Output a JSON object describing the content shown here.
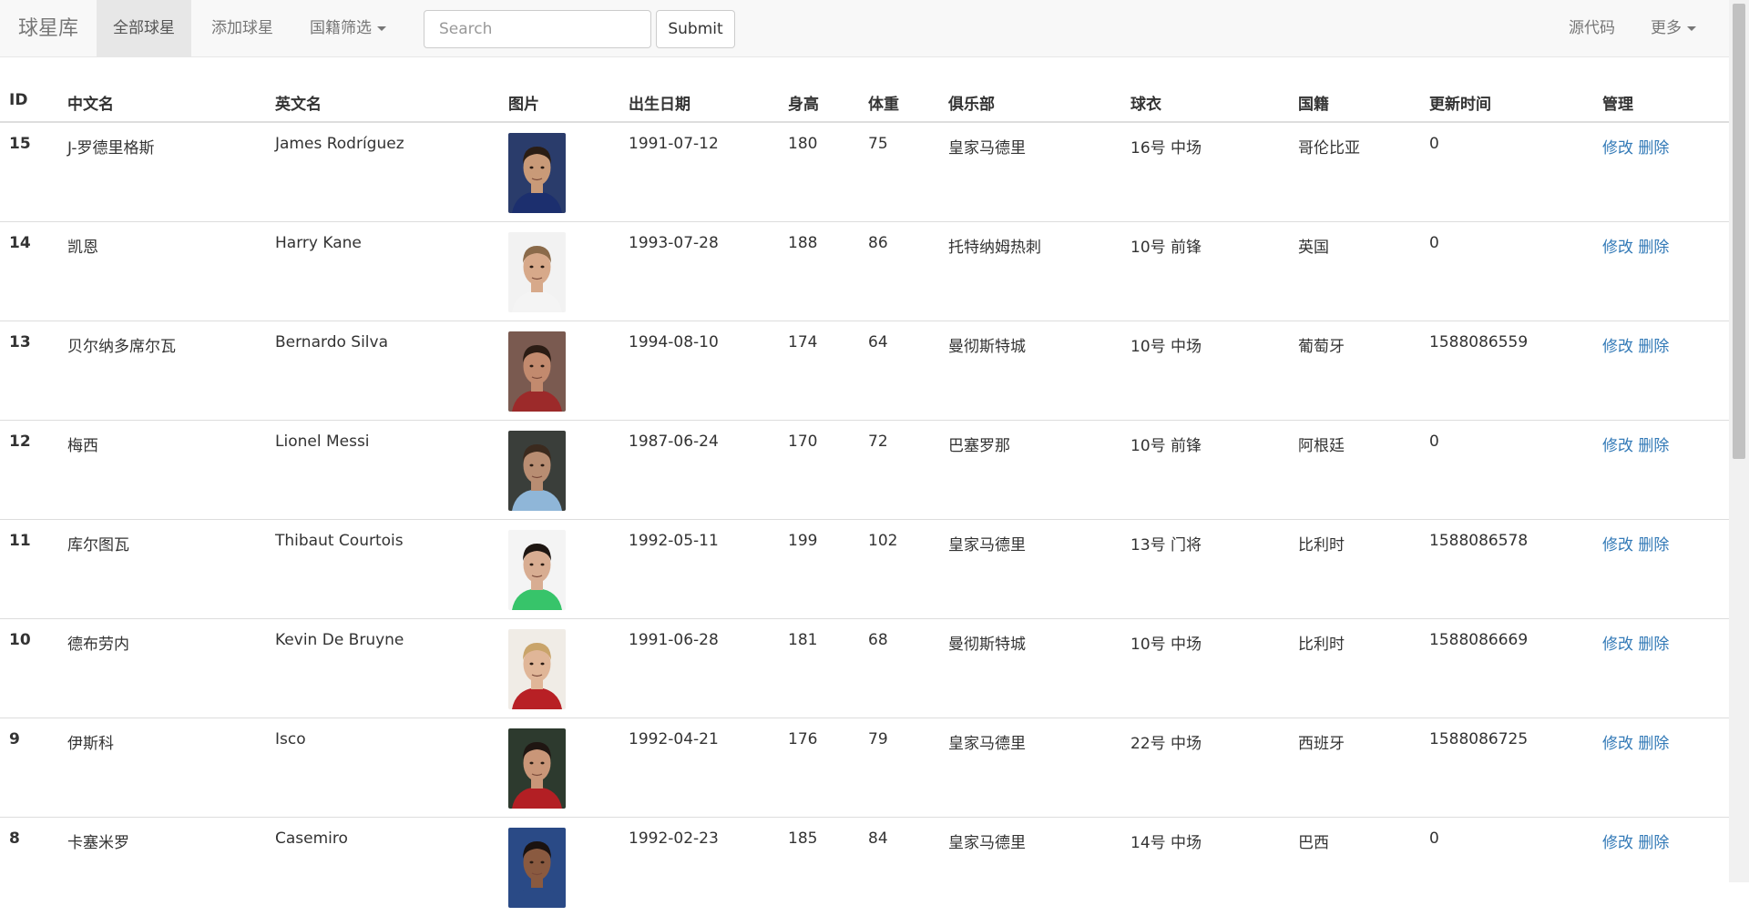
{
  "navbar": {
    "brand": "球星库",
    "items": [
      {
        "label": "全部球星"
      },
      {
        "label": "添加球星"
      },
      {
        "label": "国籍筛选"
      }
    ],
    "search_placeholder": "Search",
    "submit_label": "Submit",
    "right_items": [
      {
        "label": "源代码"
      },
      {
        "label": "更多"
      }
    ]
  },
  "table": {
    "headers": [
      "ID",
      "中文名",
      "英文名",
      "图片",
      "出生日期",
      "身高",
      "体重",
      "俱乐部",
      "球衣",
      "国籍",
      "更新时间",
      "管理"
    ],
    "rows": [
      {
        "id": "15",
        "cn": "J-罗德里格斯",
        "en": "James Rodríguez",
        "birth": "1991-07-12",
        "height": "180",
        "weight": "75",
        "club": "皇家马德里",
        "shirt": "16号 中场",
        "nation": "哥伦比亚",
        "updated": "0",
        "edit": "修改",
        "del": "删除",
        "photo": {
          "bg": "#2a3c6b",
          "skin": "#c99a78",
          "hair": "#2a1d14",
          "shirt": "#1c2f6e"
        }
      },
      {
        "id": "14",
        "cn": "凯恩",
        "en": "Harry Kane",
        "birth": "1993-07-28",
        "height": "188",
        "weight": "86",
        "club": "托特纳姆热刺",
        "shirt": "10号 前锋",
        "nation": "英国",
        "updated": "0",
        "edit": "修改",
        "del": "删除",
        "photo": {
          "bg": "#f2f2f2",
          "skin": "#d7a98a",
          "hair": "#8a6a4a",
          "shirt": "#f4f4f4"
        }
      },
      {
        "id": "13",
        "cn": "贝尔纳多席尔瓦",
        "en": "Bernardo Silva",
        "birth": "1994-08-10",
        "height": "174",
        "weight": "64",
        "club": "曼彻斯特城",
        "shirt": "10号 中场",
        "nation": "葡萄牙",
        "updated": "1588086559",
        "edit": "修改",
        "del": "删除",
        "photo": {
          "bg": "#7a5a50",
          "skin": "#c28a6e",
          "hair": "#2b1c14",
          "shirt": "#9c2a2a"
        }
      },
      {
        "id": "12",
        "cn": "梅西",
        "en": "Lionel Messi",
        "birth": "1987-06-24",
        "height": "170",
        "weight": "72",
        "club": "巴塞罗那",
        "shirt": "10号 前锋",
        "nation": "阿根廷",
        "updated": "0",
        "edit": "修改",
        "del": "删除",
        "photo": {
          "bg": "#3a3e3a",
          "skin": "#b88d72",
          "hair": "#3b2a1e",
          "shirt": "#8fb6d8"
        }
      },
      {
        "id": "11",
        "cn": "库尔图瓦",
        "en": "Thibaut Courtois",
        "birth": "1992-05-11",
        "height": "199",
        "weight": "102",
        "club": "皇家马德里",
        "shirt": "13号 门将",
        "nation": "比利时",
        "updated": "1588086578",
        "edit": "修改",
        "del": "删除",
        "photo": {
          "bg": "#f4f4f4",
          "skin": "#d8ad92",
          "hair": "#1e1612",
          "shirt": "#37c46a"
        }
      },
      {
        "id": "10",
        "cn": "德布劳内",
        "en": "Kevin De Bruyne",
        "birth": "1991-06-28",
        "height": "181",
        "weight": "68",
        "club": "曼彻斯特城",
        "shirt": "10号 中场",
        "nation": "比利时",
        "updated": "1588086669",
        "edit": "修改",
        "del": "删除",
        "photo": {
          "bg": "#f0ece6",
          "skin": "#e0b698",
          "hair": "#c9a46a",
          "shirt": "#b82025"
        }
      },
      {
        "id": "9",
        "cn": "伊斯科",
        "en": "Isco",
        "birth": "1992-04-21",
        "height": "176",
        "weight": "79",
        "club": "皇家马德里",
        "shirt": "22号 中场",
        "nation": "西班牙",
        "updated": "1588086725",
        "edit": "修改",
        "del": "删除",
        "photo": {
          "bg": "#2d3a2e",
          "skin": "#c99678",
          "hair": "#1f1612",
          "shirt": "#b31f24"
        }
      },
      {
        "id": "8",
        "cn": "卡塞米罗",
        "en": "Casemiro",
        "birth": "1992-02-23",
        "height": "185",
        "weight": "84",
        "club": "皇家马德里",
        "shirt": "14号 中场",
        "nation": "巴西",
        "updated": "0",
        "edit": "修改",
        "del": "删除",
        "photo": {
          "bg": "#2a4a86",
          "skin": "#8a5a40",
          "hair": "#1a1210",
          "shirt": "#2a4a86"
        }
      }
    ]
  },
  "colors": {
    "link": "#337ab7",
    "navbar_bg": "#f8f8f8",
    "nav_active": "#e7e7e7"
  }
}
